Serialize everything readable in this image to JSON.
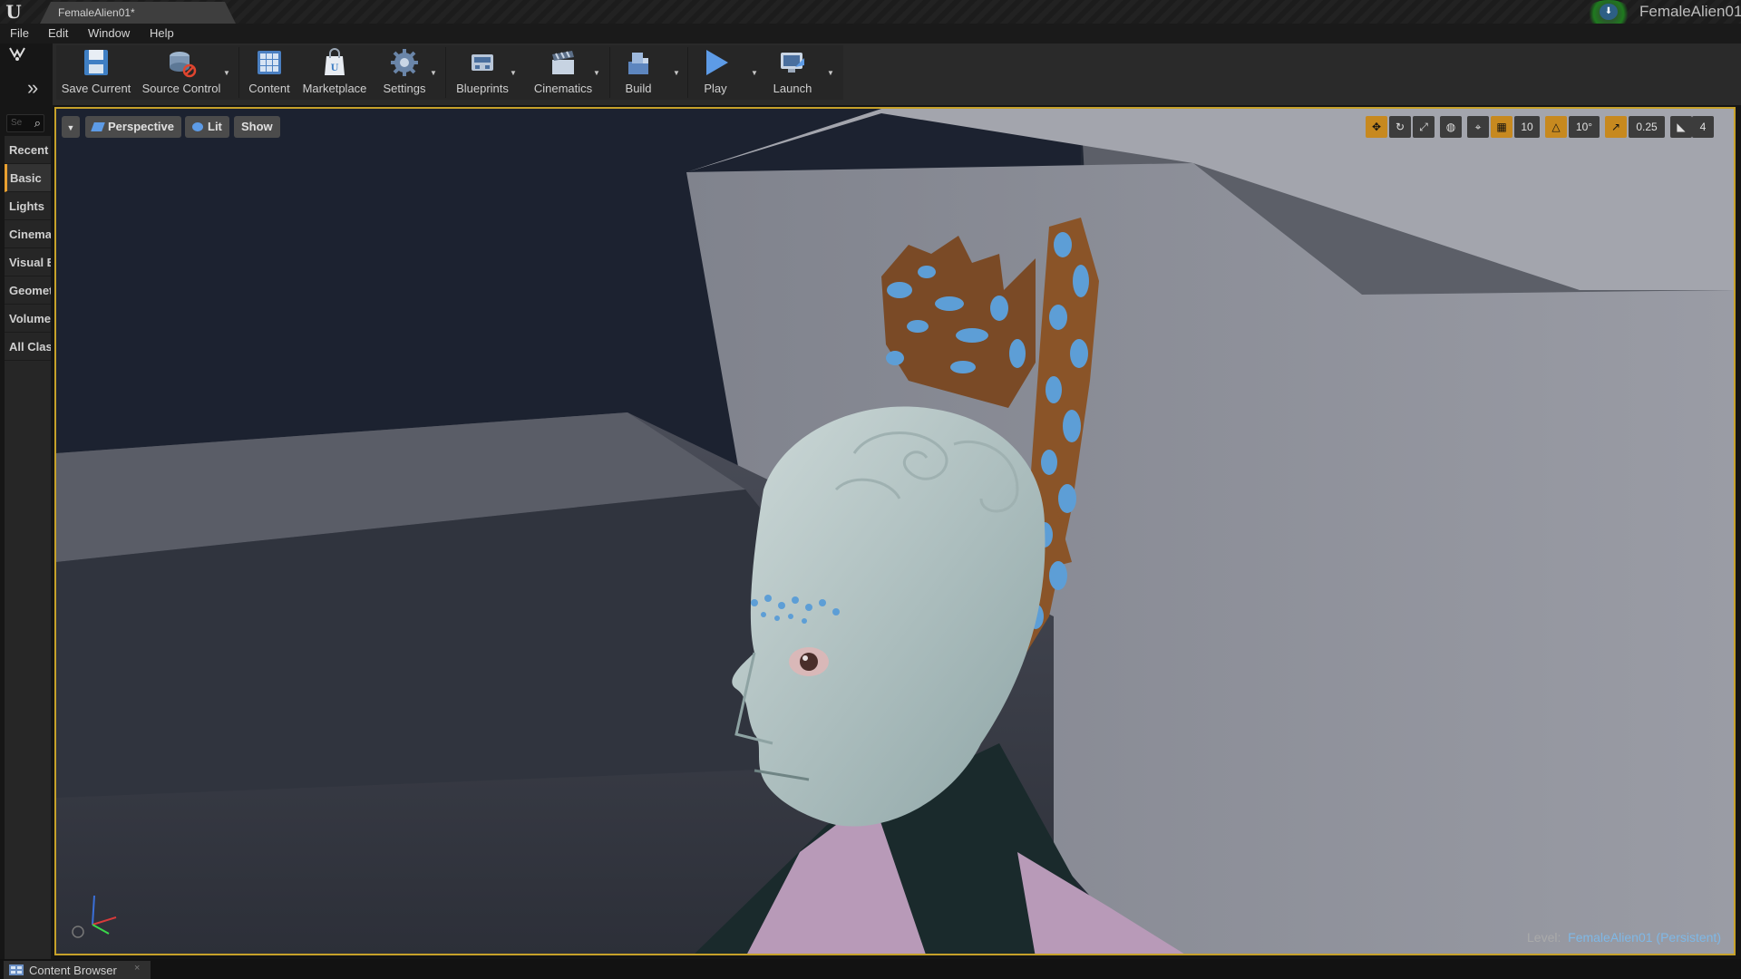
{
  "title_bar": {
    "document_tab": "FemaleAlien01*",
    "project_name": "FemaleAlien01"
  },
  "menu": [
    "File",
    "Edit",
    "Window",
    "Help"
  ],
  "modes": {
    "search_placeholder": "Se",
    "categories": [
      "Recent",
      "Basic",
      "Lights",
      "Cinematic",
      "Visual Effects",
      "Geometry",
      "Volumes",
      "All Classes"
    ],
    "active_category": "Basic"
  },
  "toolbar": {
    "save_current": "Save Current",
    "source_control": "Source Control",
    "content": "Content",
    "marketplace": "Marketplace",
    "settings": "Settings",
    "blueprints": "Blueprints",
    "cinematics": "Cinematics",
    "build": "Build",
    "play": "Play",
    "launch": "Launch"
  },
  "viewport": {
    "perspective": "Perspective",
    "lit": "Lit",
    "show": "Show",
    "grid_snap": "10",
    "rotation_snap": "10°",
    "scale_snap": "0.25",
    "camera_speed": "4",
    "level_prefix": "Level:",
    "level_name": "FemaleAlien01 (Persistent)"
  },
  "bottom": {
    "content_browser": "Content Browser"
  },
  "colors": {
    "accent": "#c6a12a",
    "level_link": "#7fb8e6",
    "snap_active": "#c7891f"
  }
}
